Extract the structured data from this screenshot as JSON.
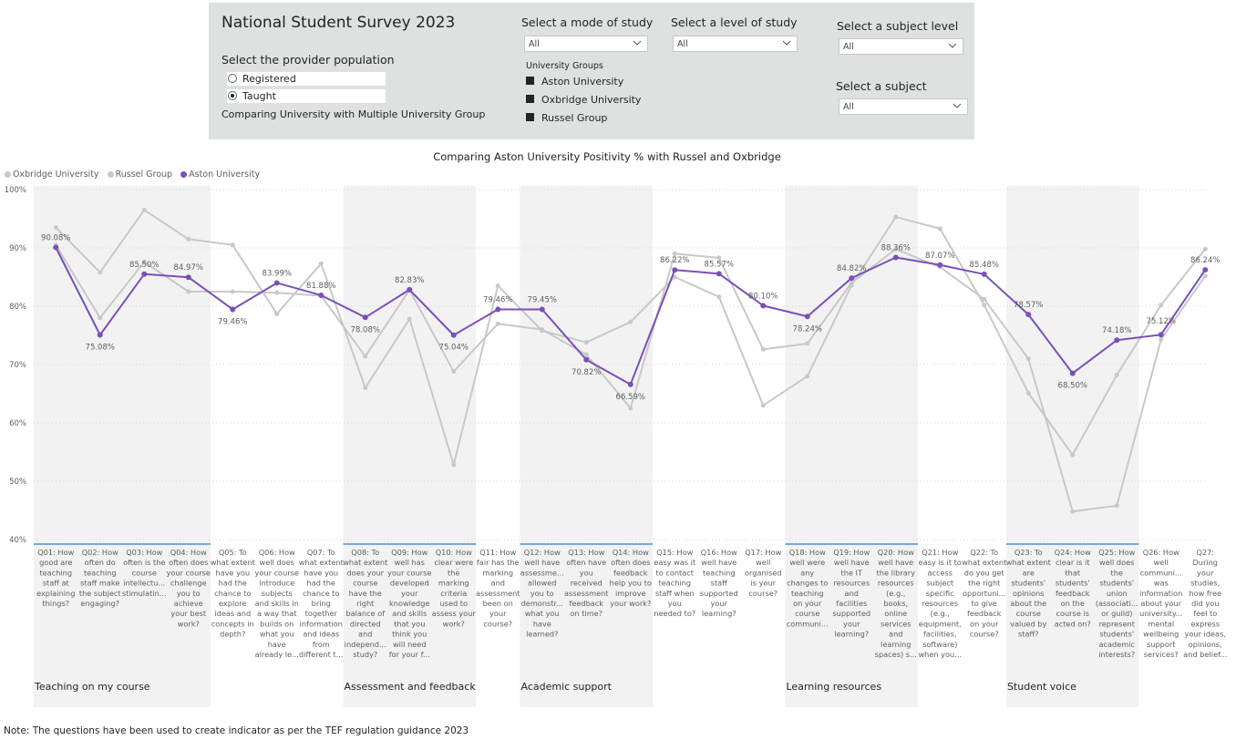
{
  "header": {
    "title": "National Student Survey 2023",
    "provider_label": "Select the provider population",
    "radios": [
      {
        "label": "Registered",
        "selected": false
      },
      {
        "label": "Taught",
        "selected": true
      }
    ],
    "comparing_text": "Comparing University with Multiple University  Group",
    "mode_label": "Select a mode of study",
    "mode_value": "All",
    "level_label": "Select a level of study",
    "level_value": "All",
    "subject_level_label": "Select a subject level",
    "subject_level_value": "All",
    "subject_label": "Select a subject",
    "subject_value": "All",
    "groups_title": "University Groups",
    "groups": [
      "Aston University",
      "Oxbridge University",
      "Russel Group"
    ]
  },
  "chart_title": "Comparing Aston University Positivity % with Russel and Oxbridge",
  "legend": [
    {
      "label": "Oxbridge University",
      "color": "#c8c8c8"
    },
    {
      "label": "Russel Group",
      "color": "#c8c8c8"
    },
    {
      "label": "Aston University",
      "color": "#7b4fb8"
    }
  ],
  "note": "Note: The questions have been used to create indicator as per the TEF regulation guidance 2023",
  "chart_data": {
    "type": "line",
    "ylim": [
      40,
      100
    ],
    "yticks": [
      "40%",
      "50%",
      "60%",
      "70%",
      "80%",
      "90%",
      "100%"
    ],
    "grid": true,
    "legend_position": "top-left",
    "categories": [
      "Q01: How good are teaching staff at explaining things?",
      "Q02: How often do teaching staff make the subject engaging?",
      "Q03: How often is the course intellectu... stimulatin...",
      "Q04: How often does your course challenge you to achieve your best work?",
      "Q05: To what extent have you had the chance to explore ideas and concepts in depth?",
      "Q06: How well does your course introduce subjects and skills in a way that builds on what you have already le...",
      "Q07: To what extent have you had the chance to bring together information and ideas from different t...",
      "Q08: To what extent does your course have the right balance of directed and independ... study?",
      "Q09: How well has your course developed your knowledge and skills that you think you will need for your f...",
      "Q10: How clear were the marking criteria used to assess your work?",
      "Q11: How fair has the marking and assessment been on your course?",
      "Q12: How well have assessme... allowed you to demonstr... what you have learned?",
      "Q13: How often have you received assessment feedback on time?",
      "Q14: How often does feedback help you to improve your work?",
      "Q15: How easy was it to contact teaching staff when you needed to?",
      "Q16: How well have teaching staff supported your learning?",
      "Q17: How well organised is your course?",
      "Q18: How well were any changes to teaching on your course communi...",
      "Q19: How well have the IT resources and facilities supported your learning?",
      "Q20: How well have the library resources (e.g., books, online services and learning spaces) s...",
      "Q21: How easy is it to access subject specific resources (e.g., equipment, facilities, software) when you...",
      "Q22: To what extent do you get the right opportuni... to give feedback on your course?",
      "Q23: To what extent are students' opinions about the course valued by staff?",
      "Q24: How clear is it that students' feedback on the course is acted on?",
      "Q25: How well does the students' union (associati... or guild) represent students' academic interests?",
      "Q26: How well communi... was information about your university... mental wellbeing support services?",
      "Q27: During your studies, how free did you feel to express your ideas, opinions, and belief..."
    ],
    "category_lines": [
      [
        "Q01: How",
        "good are",
        "teaching",
        "staff at",
        "explaining",
        "things?"
      ],
      [
        "Q02: How",
        "often do",
        "teaching",
        "staff make",
        "the subject",
        "engaging?"
      ],
      [
        "Q03: How",
        "often is the",
        "course",
        "intellectu...",
        "stimulatin..."
      ],
      [
        "Q04: How",
        "often does",
        "your course",
        "challenge",
        "you to",
        "achieve",
        "your best",
        "work?"
      ],
      [
        "Q05: To",
        "what extent",
        "have you",
        "had the",
        "chance to",
        "explore",
        "ideas and",
        "concepts in",
        "depth?"
      ],
      [
        "Q06: How",
        "well does",
        "your course",
        "introduce",
        "subjects",
        "and skills in",
        "a way that",
        "builds on",
        "what you",
        "have",
        "already le..."
      ],
      [
        "Q07: To",
        "what extent",
        "have you",
        "had the",
        "chance to",
        "bring",
        "together",
        "information",
        "and ideas",
        "from",
        "different t..."
      ],
      [
        "Q08: To",
        "what extent",
        "does your",
        "course",
        "have the",
        "right",
        "balance of",
        "directed",
        "and",
        "independ...",
        "study?"
      ],
      [
        "Q09: How",
        "well has",
        "your course",
        "developed",
        "your",
        "knowledge",
        "and skills",
        "that you",
        "think you",
        "will need",
        "for your f..."
      ],
      [
        "Q10: How",
        "clear were",
        "the",
        "marking",
        "criteria",
        "used to",
        "assess your",
        "work?"
      ],
      [
        "Q11: How",
        "fair has the",
        "marking",
        "and",
        "assessment",
        "been on",
        "your",
        "course?"
      ],
      [
        "Q12: How",
        "well have",
        "assessme...",
        "allowed",
        "you to",
        "demonstr...",
        "what you",
        "have",
        "learned?"
      ],
      [
        "Q13: How",
        "often have",
        "you",
        "received",
        "assessment",
        "feedback",
        "on time?"
      ],
      [
        "Q14: How",
        "often does",
        "feedback",
        "help you to",
        "improve",
        "your work?"
      ],
      [
        "Q15: How",
        "easy was it",
        "to contact",
        "teaching",
        "staff when",
        "you",
        "needed to?"
      ],
      [
        "Q16: How",
        "well have",
        "teaching",
        "staff",
        "supported",
        "your",
        "learning?"
      ],
      [
        "Q17: How",
        "well",
        "organised",
        "is your",
        "course?"
      ],
      [
        "Q18: How",
        "well were",
        "any",
        "changes to",
        "teaching",
        "on your",
        "course",
        "communi..."
      ],
      [
        "Q19: How",
        "well have",
        "the IT",
        "resources",
        "and",
        "facilities",
        "supported",
        "your",
        "learning?"
      ],
      [
        "Q20: How",
        "well have",
        "the library",
        "resources",
        "(e.g.,",
        "books,",
        "online",
        "services",
        "and",
        "learning",
        "spaces) s..."
      ],
      [
        "Q21: How",
        "easy is it to",
        "access",
        "subject",
        "specific",
        "resources",
        "(e.g.,",
        "equipment,",
        "facilities,",
        "software)",
        "when you..."
      ],
      [
        "Q22: To",
        "what extent",
        "do you get",
        "the right",
        "opportuni...",
        "to give",
        "feedback",
        "on your",
        "course?"
      ],
      [
        "Q23: To",
        "what extent",
        "are",
        "students'",
        "opinions",
        "about the",
        "course",
        "valued by",
        "staff?"
      ],
      [
        "Q24: How",
        "clear is it",
        "that",
        "students'",
        "feedback",
        "on the",
        "course is",
        "acted on?"
      ],
      [
        "Q25: How",
        "well does",
        "the",
        "students'",
        "union",
        "(associati...",
        "or guild)",
        "represent",
        "students'",
        "academic",
        "interests?"
      ],
      [
        "Q26: How",
        "well",
        "communi...",
        "was",
        "information",
        "about your",
        "university...",
        "mental",
        "wellbeing",
        "support",
        "services?"
      ],
      [
        "Q27:",
        "During",
        "your",
        "studies,",
        "how free",
        "did you",
        "feel to",
        "express",
        "your ideas,",
        "opinions,",
        "and belief..."
      ]
    ],
    "groups": [
      {
        "label": "Teaching on my course",
        "start": 0,
        "end": 3,
        "shaded": true
      },
      {
        "label": "",
        "start": 4,
        "end": 6,
        "shaded": false
      },
      {
        "label": "Assessment and feedback",
        "start": 7,
        "end": 9,
        "shaded": true
      },
      {
        "label": "",
        "start": 10,
        "end": 10,
        "shaded": false
      },
      {
        "label": "Academic support",
        "start": 11,
        "end": 13,
        "shaded": true
      },
      {
        "label": "",
        "start": 14,
        "end": 16,
        "shaded": false
      },
      {
        "label": "Learning resources",
        "start": 17,
        "end": 19,
        "shaded": true
      },
      {
        "label": "",
        "start": 20,
        "end": 21,
        "shaded": false
      },
      {
        "label": "Student voice",
        "start": 22,
        "end": 24,
        "shaded": true
      },
      {
        "label": "",
        "start": 25,
        "end": 26,
        "shaded": false
      }
    ],
    "series": [
      {
        "name": "Oxbridge University",
        "color": "#c8c8c8",
        "values": [
          93.5,
          85.8,
          96.5,
          91.5,
          90.5,
          78.7,
          87.3,
          66.0,
          77.8,
          52.8,
          83.5,
          75.8,
          73.8,
          77.3,
          85.0,
          81.6,
          63.0,
          68.0,
          83.6,
          95.3,
          93.3,
          80.2,
          65.1,
          54.5,
          68.2,
          80.2,
          89.8
        ]
      },
      {
        "name": "Russel Group",
        "color": "#c8c8c8",
        "values": [
          90.5,
          78.0,
          87.6,
          82.5,
          82.5,
          82.3,
          81.8,
          71.4,
          82.8,
          68.8,
          77.0,
          76.0,
          71.7,
          62.5,
          89.0,
          88.3,
          72.6,
          73.6,
          84.0,
          89.8,
          86.7,
          81.2,
          71.0,
          44.8,
          45.8,
          74.3,
          85.2
        ]
      },
      {
        "name": "Aston University",
        "color": "#7b4fb8",
        "values": [
          90.08,
          75.08,
          85.5,
          84.97,
          79.46,
          83.99,
          81.88,
          78.08,
          82.83,
          75.04,
          79.46,
          79.45,
          70.82,
          66.59,
          86.22,
          85.57,
          80.1,
          78.24,
          84.82,
          88.36,
          87.07,
          85.48,
          78.57,
          68.5,
          74.18,
          75.12,
          86.24
        ]
      }
    ],
    "data_labels": [
      "90.08%",
      "75.08%",
      "85.50%",
      "84.97%",
      "79.46%",
      "83.99%",
      "81.88%",
      "78.08%",
      "82.83%",
      "75.04%",
      "79.46%",
      "79.45%",
      "70.82%",
      "66.59%",
      "86.22%",
      "85.57%",
      "80.10%",
      "78.24%",
      "84.82%",
      "88.36%",
      "87.07%",
      "85.48%",
      "78.57%",
      "68.50%",
      "74.18%",
      "75.12%",
      "86.24%"
    ]
  }
}
